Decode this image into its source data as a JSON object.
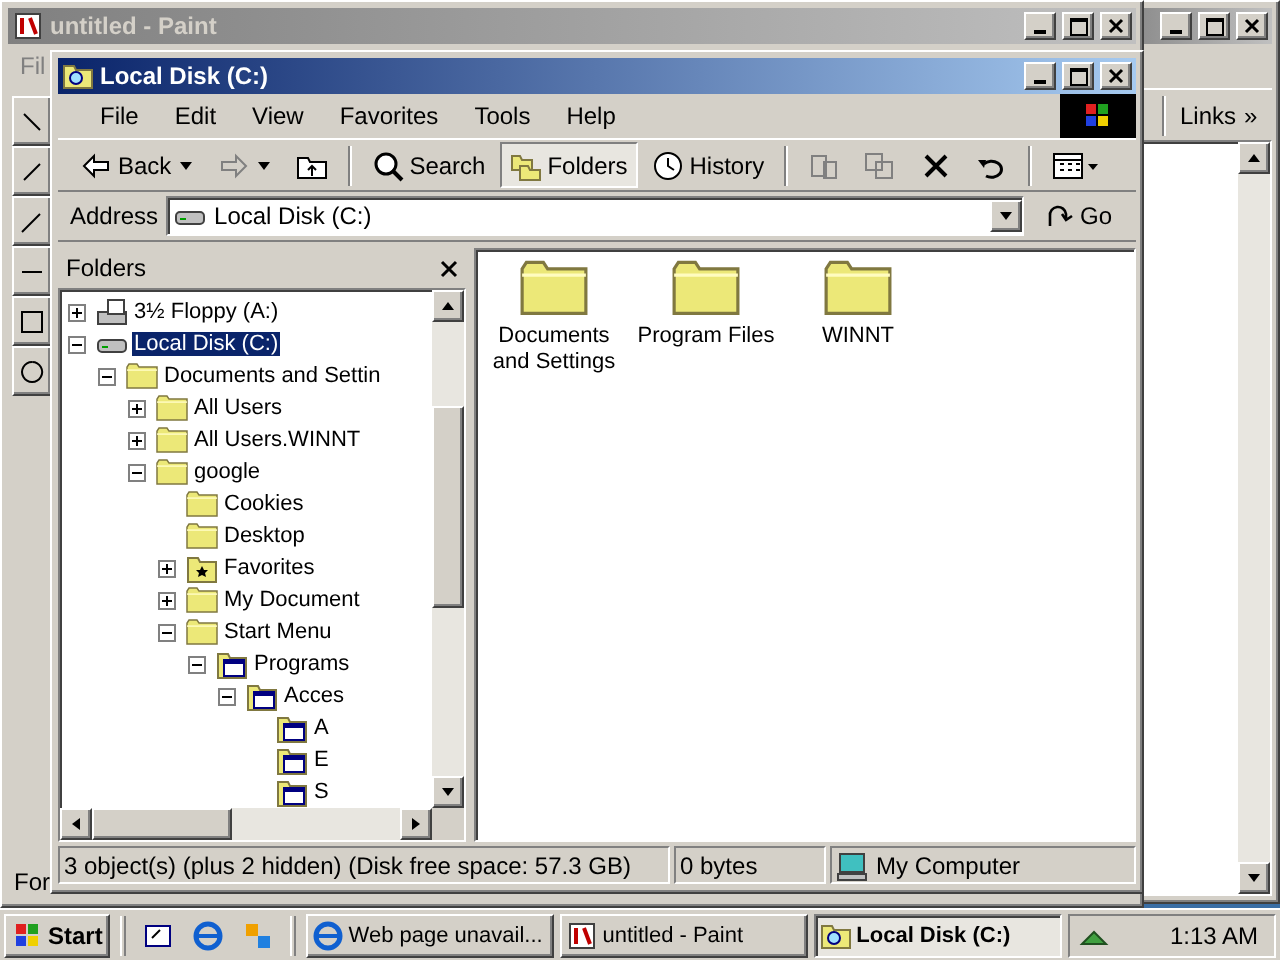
{
  "paint_window": {
    "title": "untitled - Paint",
    "menu": [
      "Fil"
    ],
    "status": "For"
  },
  "browser_window": {
    "links": "Links",
    "chevron": "»"
  },
  "window": {
    "title": "Local Disk (C:)"
  },
  "menu": [
    "File",
    "Edit",
    "View",
    "Favorites",
    "Tools",
    "Help"
  ],
  "toolbar": [
    {
      "kind": "back",
      "label": "Back",
      "disabled": false,
      "pressed": false
    },
    {
      "kind": "forward",
      "disabled": true,
      "pressed": false
    },
    {
      "kind": "up",
      "disabled": false,
      "pressed": false
    },
    {
      "kind": "search",
      "label": "Search",
      "disabled": false,
      "pressed": false
    },
    {
      "kind": "folders",
      "label": "Folders",
      "disabled": false,
      "pressed": true
    },
    {
      "kind": "history",
      "label": "History",
      "disabled": false,
      "pressed": false
    },
    {
      "kind": "move",
      "disabled": true,
      "pressed": false
    },
    {
      "kind": "copy",
      "disabled": true,
      "pressed": false
    },
    {
      "kind": "delete",
      "disabled": false,
      "pressed": false
    },
    {
      "kind": "undo",
      "disabled": false,
      "pressed": false
    },
    {
      "kind": "views",
      "disabled": false,
      "pressed": false
    }
  ],
  "address": {
    "label": "Address",
    "value": "Local Disk (C:)",
    "go": "Go"
  },
  "folders_pane": {
    "title": "Folders",
    "tree": [
      {
        "label": "3½ Floppy (A:)",
        "kind": "floppy",
        "expanded": false,
        "selected": false
      },
      {
        "label": "Local Disk (C:)",
        "kind": "drive",
        "expanded": true,
        "selected": true,
        "children": [
          {
            "label": "Documents and Settin",
            "kind": "folder",
            "expanded": true,
            "selected": false,
            "children": [
              {
                "label": "All Users",
                "kind": "folder",
                "expanded": false,
                "selected": false
              },
              {
                "label": "All Users.WINNT",
                "kind": "folder",
                "expanded": false,
                "selected": false
              },
              {
                "label": "google",
                "kind": "folder",
                "expanded": true,
                "selected": false,
                "children": [
                  {
                    "label": "Cookies",
                    "kind": "folder",
                    "selected": false
                  },
                  {
                    "label": "Desktop",
                    "kind": "folder",
                    "selected": false
                  },
                  {
                    "label": "Favorites",
                    "kind": "favorites",
                    "expanded": false,
                    "selected": false
                  },
                  {
                    "label": "My Document",
                    "kind": "folder",
                    "expanded": false,
                    "selected": false
                  },
                  {
                    "label": "Start Menu",
                    "kind": "folder",
                    "expanded": true,
                    "selected": false,
                    "children": [
                      {
                        "label": "Programs",
                        "kind": "program",
                        "expanded": true,
                        "selected": false,
                        "children": [
                          {
                            "label": "Acces",
                            "kind": "program",
                            "expanded": true,
                            "selected": false,
                            "children": [
                              {
                                "label": "A",
                                "kind": "program",
                                "selected": false
                              },
                              {
                                "label": "E",
                                "kind": "program",
                                "selected": false
                              },
                              {
                                "label": "S",
                                "kind": "program",
                                "selected": false
                              }
                            ]
                          }
                        ]
                      }
                    ]
                  }
                ]
              }
            ]
          }
        ]
      }
    ]
  },
  "items": [
    {
      "name": "Documents and Settings"
    },
    {
      "name": "Program Files"
    },
    {
      "name": "WINNT"
    }
  ],
  "status_bar": [
    "3 object(s) (plus 2 hidden) (Disk free space: 57.3 GB)",
    "0 bytes",
    "My Computer"
  ],
  "taskbar": {
    "start": "Start",
    "tasks": [
      {
        "label": "Web page unavail...",
        "kind": "ie",
        "selected": false
      },
      {
        "label": "untitled - Paint",
        "kind": "paint",
        "selected": false
      },
      {
        "label": "Local Disk (C:)",
        "kind": "explorer",
        "selected": true
      }
    ],
    "clock": "1:13 AM"
  }
}
